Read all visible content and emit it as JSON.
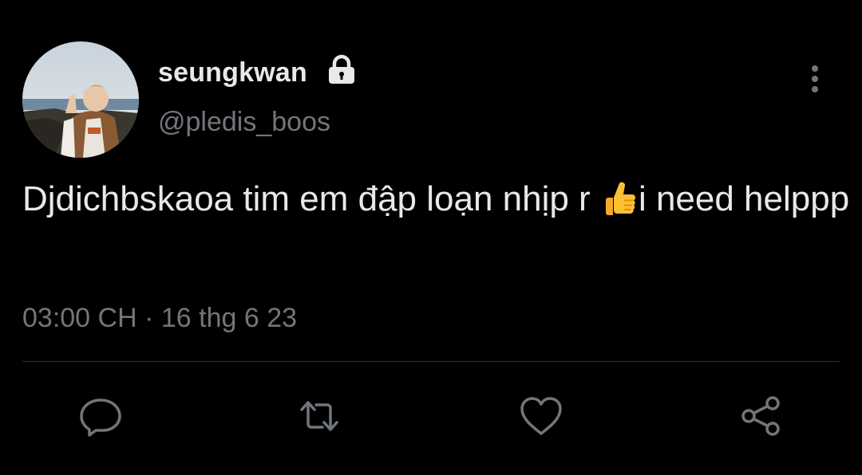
{
  "tweet": {
    "display_name": "seungkwan",
    "handle": "@pledis_boos",
    "text_before_emoji": "Djdichbskaoa tim em đập loạn nhịp r ",
    "emoji_name": "thumbs-up",
    "text_after_emoji": "i need helppp",
    "time": "03:00 CH",
    "separator": "·",
    "date": "16 thg 6 23",
    "protected": true
  },
  "actions": [
    {
      "name": "reply",
      "icon": "reply-icon"
    },
    {
      "name": "retweet",
      "icon": "retweet-icon"
    },
    {
      "name": "like",
      "icon": "heart-icon"
    },
    {
      "name": "share",
      "icon": "share-icon"
    }
  ],
  "colors": {
    "background": "#000000",
    "primary_text": "#e7e9ea",
    "secondary_text": "#71767b",
    "divider": "#2f3336"
  }
}
